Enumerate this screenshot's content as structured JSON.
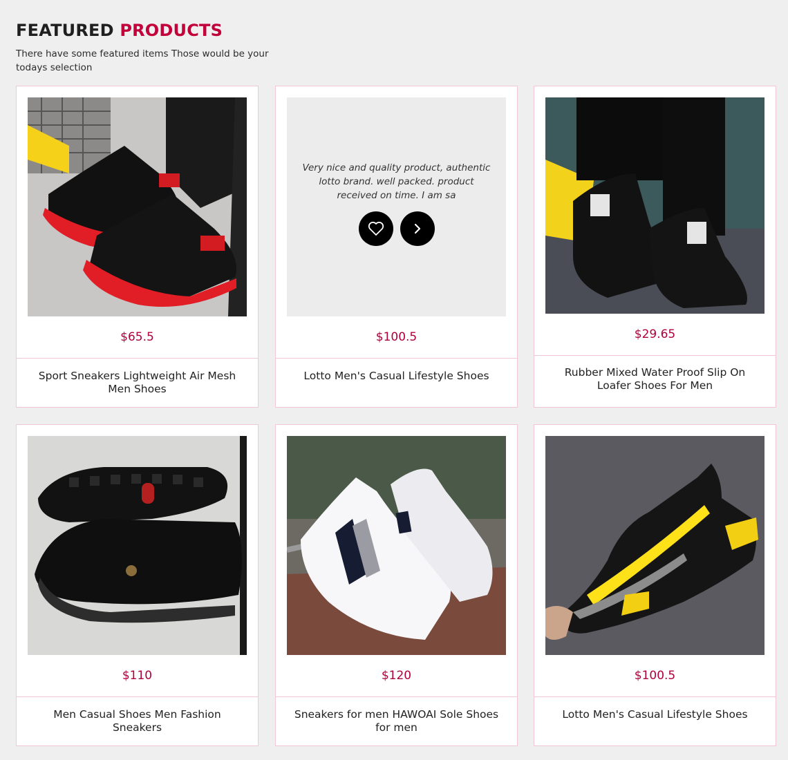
{
  "section": {
    "title_part1": "FEATURED",
    "title_part2": "PRODUCTS",
    "subtitle": "There have some featured items Those would be your todays selection"
  },
  "colors": {
    "accent": "#c2003a",
    "price": "#b0003a",
    "card_border": "#f0c7d3",
    "background": "#efefef"
  },
  "products": [
    {
      "image_icon": "red-black-sneaker-photo",
      "price": "$65.5",
      "name": "Sport Sneakers Lightweight Air Mesh Men Shoes"
    },
    {
      "image_icon": "hover-review-overlay",
      "review_text": "Very nice and quality product, authentic lotto brand. well packed. product received on time. I am sa",
      "wishlist_icon": "heart-icon",
      "details_icon": "chevron-right-icon",
      "price": "$100.5",
      "name": "Lotto Men's Casual Lifestyle Shoes"
    },
    {
      "image_icon": "black-mesh-sneaker-photo",
      "price": "$29.65",
      "name": "Rubber Mixed Water Proof Slip On Loafer Shoes For Men"
    },
    {
      "image_icon": "black-loafer-photo",
      "price": "$110",
      "name": "Men Casual Shoes Men Fashion Sneakers"
    },
    {
      "image_icon": "white-sneaker-photo",
      "price": "$120",
      "name": "Sneakers for men HAWOAI Sole Shoes for men"
    },
    {
      "image_icon": "black-yellow-sneaker-photo",
      "price": "$100.5",
      "name": "Lotto Men's Casual Lifestyle Shoes"
    }
  ]
}
